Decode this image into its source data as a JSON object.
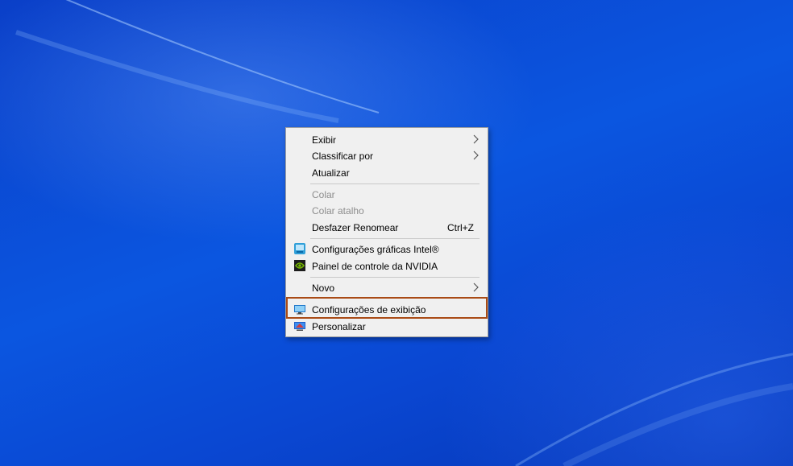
{
  "menu": {
    "items": [
      {
        "label": "Exibir"
      },
      {
        "label": "Classificar por"
      },
      {
        "label": "Atualizar"
      },
      {
        "label": "Colar"
      },
      {
        "label": "Colar atalho"
      },
      {
        "label": "Desfazer Renomear",
        "shortcut": "Ctrl+Z"
      },
      {
        "label": "Configurações gráficas Intel®"
      },
      {
        "label": "Painel de controle da NVIDIA"
      },
      {
        "label": "Novo"
      },
      {
        "label": "Configurações de exibição"
      },
      {
        "label": "Personalizar"
      }
    ]
  },
  "icons": {
    "submenu": "chevron-right-icon",
    "intel": "intel-graphics-icon",
    "nvidia": "nvidia-icon",
    "display": "display-settings-icon",
    "personalize": "personalize-icon"
  },
  "colors": {
    "desktop": "#0b4fd6",
    "menu_bg": "#f0f0f0",
    "highlight_border": "#a94b16",
    "disabled_text": "#8d8d8d"
  }
}
